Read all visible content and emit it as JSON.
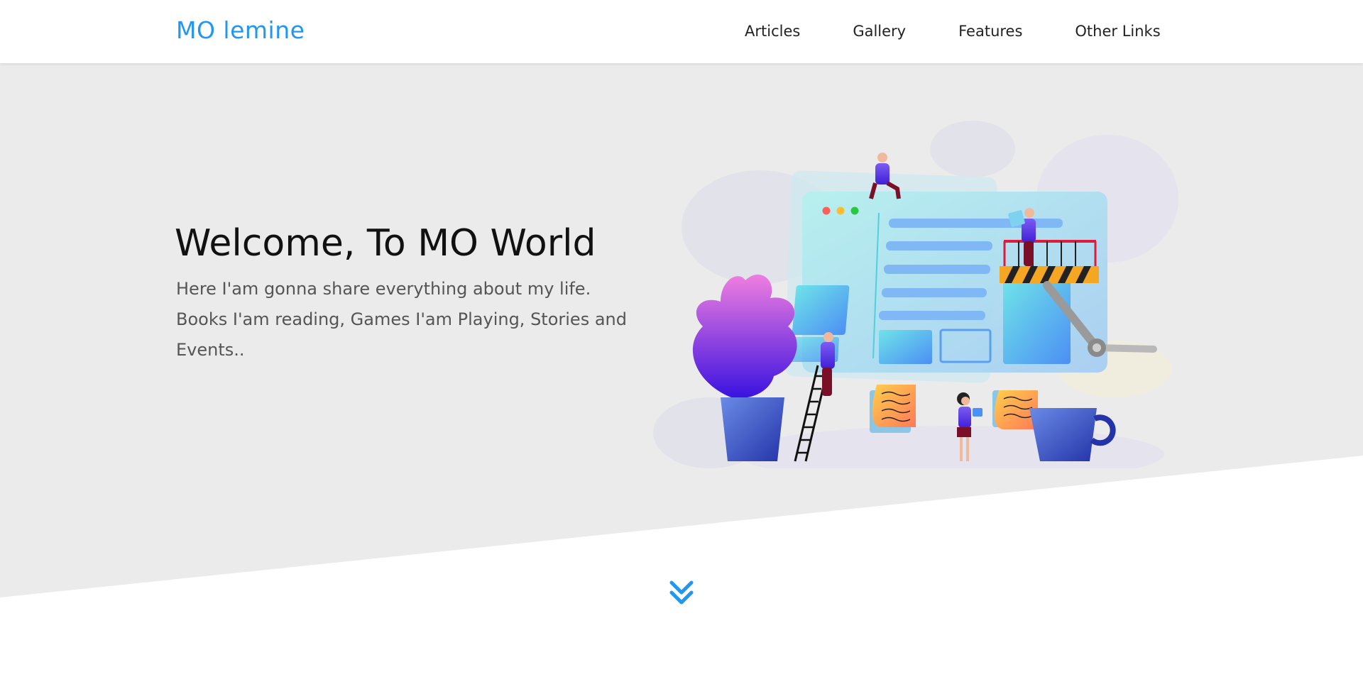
{
  "header": {
    "logo": "MO lemine",
    "nav": [
      "Articles",
      "Gallery",
      "Features",
      "Other Links"
    ]
  },
  "hero": {
    "title": "Welcome, To MO World",
    "text": "Here I'am gonna share everything about my life. Books I'am reading, Games I'am Playing, Stories and Events.."
  },
  "icons": {
    "scroll": "double-chevron-down-icon",
    "illustration": "web-development-illustration"
  },
  "colors": {
    "accent": "#2196f3",
    "hero_bg": "#ebebeb",
    "text_dark": "#111111",
    "text_muted": "#555555"
  }
}
